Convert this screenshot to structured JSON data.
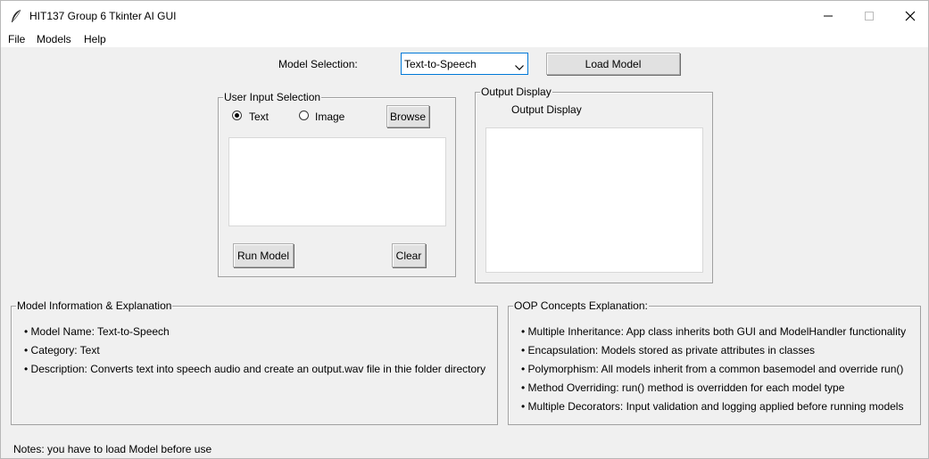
{
  "window": {
    "title": "HIT137 Group 6 Tkinter AI GUI"
  },
  "menu": {
    "items": [
      "File",
      "Models",
      "Help"
    ]
  },
  "model_selection": {
    "label": "Model Selection:",
    "selected": "Text-to-Speech",
    "load_button": "Load Model"
  },
  "user_input": {
    "group_title": "User Input Selection",
    "radio_text": "Text",
    "radio_image": "Image",
    "selected": "Text",
    "browse_button": "Browse",
    "input_value": "",
    "run_button": "Run Model",
    "clear_button": "Clear"
  },
  "output": {
    "group_title": "Output Display",
    "label": "Output Display",
    "value": ""
  },
  "model_info": {
    "group_title": "Model Information & Explanation",
    "lines": [
      "• Model Name: Text-to-Speech",
      "• Category: Text",
      "• Description: Converts text into speech audio and create an output.wav file in thie folder directory"
    ]
  },
  "oop": {
    "group_title": "OOP Concepts Explanation:",
    "lines": [
      "• Multiple Inheritance: App class inherits both GUI and ModelHandler functionality",
      "• Encapsulation: Models stored as private attributes in classes",
      "• Polymorphism: All models inherit from a common basemodel and override run()",
      "• Method Overriding: run() method is overridden for each model type",
      "• Multiple Decorators: Input validation and logging applied before running models"
    ]
  },
  "notes": "Notes: you have to load Model before use"
}
